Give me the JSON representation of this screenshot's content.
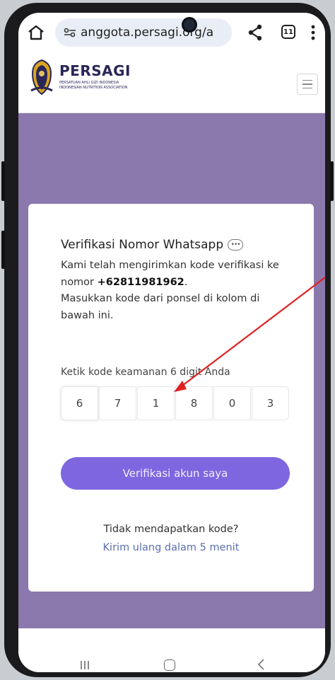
{
  "browser": {
    "url": "anggota.persagi.org/a",
    "tab_count": "11"
  },
  "site": {
    "logo_title": "PERSAGI",
    "logo_subtitle_line1": "PERSATUAN AHLI GIZI INDONESIA",
    "logo_subtitle_line2": "INDONESIAN NUTRITION ASSOCIATION"
  },
  "card": {
    "title": "Verifikasi Nomor Whatsapp",
    "desc_prefix": "Kami telah mengirimkan kode verifikasi ke nomor ",
    "phone_number": "+62811981962",
    "desc_suffix": ".",
    "instruction": "Masukkan kode dari ponsel di kolom di bawah ini.",
    "code_label": "Ketik kode keamanan 6 digit Anda",
    "otp_digits": [
      "6",
      "7",
      "1",
      "8",
      "0",
      "3"
    ],
    "verify_button": "Verifikasi akun saya",
    "no_code_text": "Tidak mendapatkan kode?",
    "resend_text": "Kirim ulang dalam 5 menit"
  },
  "colors": {
    "page_background": "#8b78ac",
    "button": "#7e66e0",
    "link": "#5b6fb0",
    "annotation_arrow": "#e02020"
  },
  "icons": [
    "home-icon",
    "tune-icon",
    "share-icon",
    "tabs-icon",
    "more-vert-icon",
    "menu-icon",
    "more-horiz-icon",
    "nav-recent-icon",
    "nav-home-icon",
    "nav-back-icon"
  ]
}
